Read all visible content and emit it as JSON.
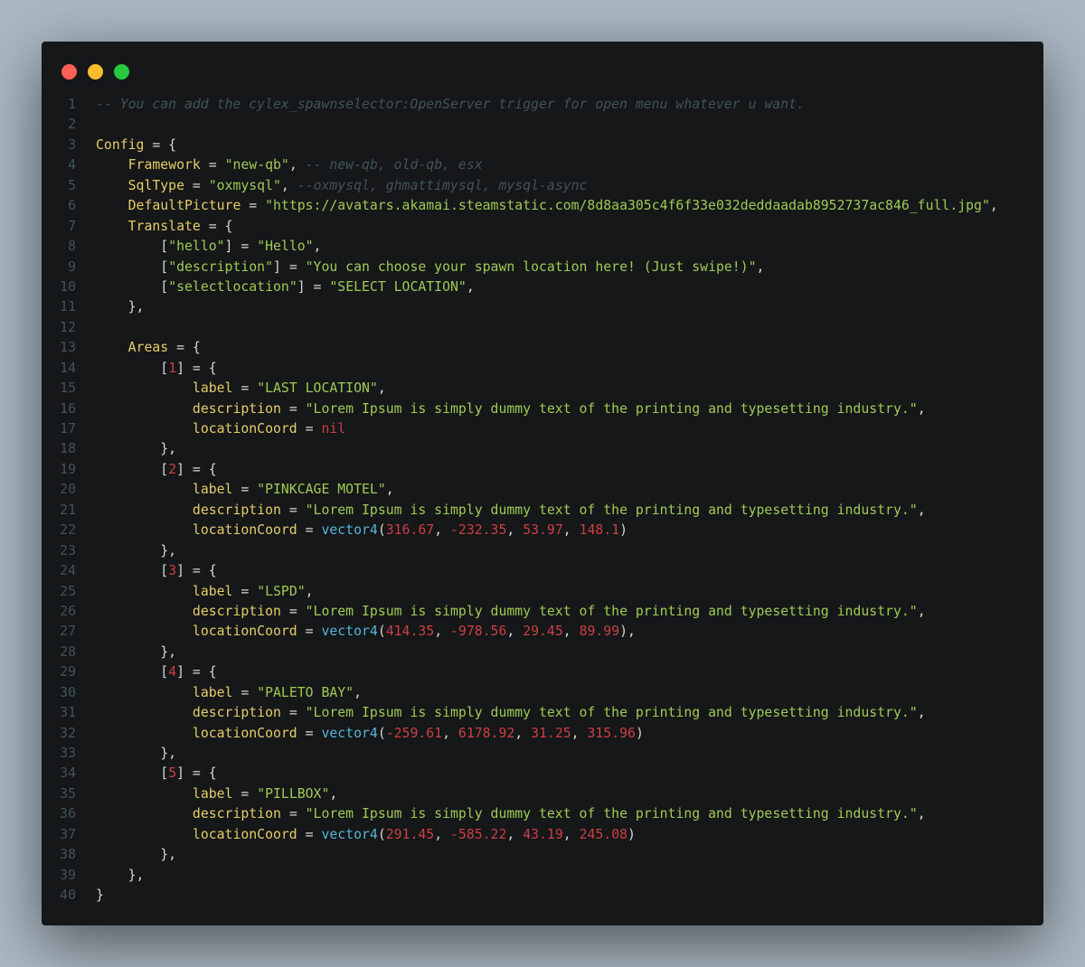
{
  "window": {
    "controls": [
      {
        "name": "close",
        "color": "#ff5f56"
      },
      {
        "name": "minimize",
        "color": "#ffbd2e"
      },
      {
        "name": "maximize",
        "color": "#27c93f"
      }
    ]
  },
  "theme": {
    "background": "#abb8c3",
    "editor_bg": "#151718",
    "line_number": "#41535b",
    "default": "#d4d7d6",
    "key": "#e6cd69",
    "string": "#9fca56",
    "comment": "#41535b",
    "number": "#cd3f45",
    "keyword": "#e6cd69",
    "function": "#55b5db",
    "ident": "#e6cd69"
  },
  "code": {
    "lines": [
      {
        "n": "1",
        "tokens": [
          [
            "c",
            "-- You can add the cylex_spawnselector:OpenServer trigger for open menu whatever u want."
          ]
        ]
      },
      {
        "n": "2",
        "tokens": []
      },
      {
        "n": "3",
        "tokens": [
          [
            "k",
            "Config"
          ],
          [
            "p",
            " = {"
          ]
        ]
      },
      {
        "n": "4",
        "tokens": [
          [
            "p",
            "    "
          ],
          [
            "k",
            "Framework"
          ],
          [
            "p",
            " = "
          ],
          [
            "s",
            "\"new-qb\""
          ],
          [
            "p",
            ", "
          ],
          [
            "c",
            "-- new-qb, old-qb, esx"
          ]
        ]
      },
      {
        "n": "5",
        "tokens": [
          [
            "p",
            "    "
          ],
          [
            "k",
            "SqlType"
          ],
          [
            "p",
            " = "
          ],
          [
            "s",
            "\"oxmysql\""
          ],
          [
            "p",
            ", "
          ],
          [
            "c",
            "--oxmysql, ghmattimysql, mysql-async"
          ]
        ]
      },
      {
        "n": "6",
        "tokens": [
          [
            "p",
            "    "
          ],
          [
            "k",
            "DefaultPicture"
          ],
          [
            "p",
            " = "
          ],
          [
            "s",
            "\"https://avatars.akamai.steamstatic.com/8d8aa305c4f6f33e032deddaadab8952737ac846_full.jpg\""
          ],
          [
            "p",
            ","
          ]
        ]
      },
      {
        "n": "7",
        "tokens": [
          [
            "p",
            "    "
          ],
          [
            "k",
            "Translate"
          ],
          [
            "p",
            " = {"
          ]
        ]
      },
      {
        "n": "8",
        "tokens": [
          [
            "p",
            "        ["
          ],
          [
            "s",
            "\"hello\""
          ],
          [
            "p",
            "] = "
          ],
          [
            "s",
            "\"Hello\""
          ],
          [
            "p",
            ","
          ]
        ]
      },
      {
        "n": "9",
        "tokens": [
          [
            "p",
            "        ["
          ],
          [
            "s",
            "\"description\""
          ],
          [
            "p",
            "] = "
          ],
          [
            "s",
            "\"You can choose your spawn location here! (Just swipe!)\""
          ],
          [
            "p",
            ","
          ]
        ]
      },
      {
        "n": "10",
        "tokens": [
          [
            "p",
            "        ["
          ],
          [
            "s",
            "\"selectlocation\""
          ],
          [
            "p",
            "] = "
          ],
          [
            "s",
            "\"SELECT LOCATION\""
          ],
          [
            "p",
            ","
          ]
        ]
      },
      {
        "n": "11",
        "tokens": [
          [
            "p",
            "    },"
          ]
        ]
      },
      {
        "n": "12",
        "tokens": []
      },
      {
        "n": "13",
        "tokens": [
          [
            "p",
            "    "
          ],
          [
            "k",
            "Areas"
          ],
          [
            "p",
            " = {"
          ]
        ]
      },
      {
        "n": "14",
        "tokens": [
          [
            "p",
            "        ["
          ],
          [
            "n",
            "1"
          ],
          [
            "p",
            "] = {"
          ]
        ]
      },
      {
        "n": "15",
        "tokens": [
          [
            "p",
            "            "
          ],
          [
            "k",
            "label"
          ],
          [
            "p",
            " = "
          ],
          [
            "s",
            "\"LAST LOCATION\""
          ],
          [
            "p",
            ","
          ]
        ]
      },
      {
        "n": "16",
        "tokens": [
          [
            "p",
            "            "
          ],
          [
            "k",
            "description"
          ],
          [
            "p",
            " = "
          ],
          [
            "s",
            "\"Lorem Ipsum is simply dummy text of the printing and typesetting industry.\""
          ],
          [
            "p",
            ","
          ]
        ]
      },
      {
        "n": "17",
        "tokens": [
          [
            "p",
            "            "
          ],
          [
            "k",
            "locationCoord"
          ],
          [
            "p",
            " = "
          ],
          [
            "n",
            "nil"
          ]
        ]
      },
      {
        "n": "18",
        "tokens": [
          [
            "p",
            "        },"
          ]
        ]
      },
      {
        "n": "19",
        "tokens": [
          [
            "p",
            "        ["
          ],
          [
            "n",
            "2"
          ],
          [
            "p",
            "] = {"
          ]
        ]
      },
      {
        "n": "20",
        "tokens": [
          [
            "p",
            "            "
          ],
          [
            "k",
            "label"
          ],
          [
            "p",
            " = "
          ],
          [
            "s",
            "\"PINKCAGE MOTEL\""
          ],
          [
            "p",
            ","
          ]
        ]
      },
      {
        "n": "21",
        "tokens": [
          [
            "p",
            "            "
          ],
          [
            "k",
            "description"
          ],
          [
            "p",
            " = "
          ],
          [
            "s",
            "\"Lorem Ipsum is simply dummy text of the printing and typesetting industry.\""
          ],
          [
            "p",
            ","
          ]
        ]
      },
      {
        "n": "22",
        "tokens": [
          [
            "p",
            "            "
          ],
          [
            "k",
            "locationCoord"
          ],
          [
            "p",
            " = "
          ],
          [
            "f",
            "vector4"
          ],
          [
            "p",
            "("
          ],
          [
            "n",
            "316.67"
          ],
          [
            "p",
            ", "
          ],
          [
            "n",
            "-232.35"
          ],
          [
            "p",
            ", "
          ],
          [
            "n",
            "53.97"
          ],
          [
            "p",
            ", "
          ],
          [
            "n",
            "148.1"
          ],
          [
            "p",
            ")"
          ]
        ]
      },
      {
        "n": "23",
        "tokens": [
          [
            "p",
            "        },"
          ]
        ]
      },
      {
        "n": "24",
        "tokens": [
          [
            "p",
            "        ["
          ],
          [
            "n",
            "3"
          ],
          [
            "p",
            "] = {"
          ]
        ]
      },
      {
        "n": "25",
        "tokens": [
          [
            "p",
            "            "
          ],
          [
            "k",
            "label"
          ],
          [
            "p",
            " = "
          ],
          [
            "s",
            "\"LSPD\""
          ],
          [
            "p",
            ","
          ]
        ]
      },
      {
        "n": "26",
        "tokens": [
          [
            "p",
            "            "
          ],
          [
            "k",
            "description"
          ],
          [
            "p",
            " = "
          ],
          [
            "s",
            "\"Lorem Ipsum is simply dummy text of the printing and typesetting industry.\""
          ],
          [
            "p",
            ","
          ]
        ]
      },
      {
        "n": "27",
        "tokens": [
          [
            "p",
            "            "
          ],
          [
            "k",
            "locationCoord"
          ],
          [
            "p",
            " = "
          ],
          [
            "f",
            "vector4"
          ],
          [
            "p",
            "("
          ],
          [
            "n",
            "414.35"
          ],
          [
            "p",
            ", "
          ],
          [
            "n",
            "-978.56"
          ],
          [
            "p",
            ", "
          ],
          [
            "n",
            "29.45"
          ],
          [
            "p",
            ", "
          ],
          [
            "n",
            "89.99"
          ],
          [
            "p",
            "),"
          ]
        ]
      },
      {
        "n": "28",
        "tokens": [
          [
            "p",
            "        },"
          ]
        ]
      },
      {
        "n": "29",
        "tokens": [
          [
            "p",
            "        ["
          ],
          [
            "n",
            "4"
          ],
          [
            "p",
            "] = {"
          ]
        ]
      },
      {
        "n": "30",
        "tokens": [
          [
            "p",
            "            "
          ],
          [
            "k",
            "label"
          ],
          [
            "p",
            " = "
          ],
          [
            "s",
            "\"PALETO BAY\""
          ],
          [
            "p",
            ","
          ]
        ]
      },
      {
        "n": "31",
        "tokens": [
          [
            "p",
            "            "
          ],
          [
            "k",
            "description"
          ],
          [
            "p",
            " = "
          ],
          [
            "s",
            "\"Lorem Ipsum is simply dummy text of the printing and typesetting industry.\""
          ],
          [
            "p",
            ","
          ]
        ]
      },
      {
        "n": "32",
        "tokens": [
          [
            "p",
            "            "
          ],
          [
            "k",
            "locationCoord"
          ],
          [
            "p",
            " = "
          ],
          [
            "f",
            "vector4"
          ],
          [
            "p",
            "("
          ],
          [
            "n",
            "-259.61"
          ],
          [
            "p",
            ", "
          ],
          [
            "n",
            "6178.92"
          ],
          [
            "p",
            ", "
          ],
          [
            "n",
            "31.25"
          ],
          [
            "p",
            ", "
          ],
          [
            "n",
            "315.96"
          ],
          [
            "p",
            ")"
          ]
        ]
      },
      {
        "n": "33",
        "tokens": [
          [
            "p",
            "        },"
          ]
        ]
      },
      {
        "n": "34",
        "tokens": [
          [
            "p",
            "        ["
          ],
          [
            "n",
            "5"
          ],
          [
            "p",
            "] = {"
          ]
        ]
      },
      {
        "n": "35",
        "tokens": [
          [
            "p",
            "            "
          ],
          [
            "k",
            "label"
          ],
          [
            "p",
            " = "
          ],
          [
            "s",
            "\"PILLBOX\""
          ],
          [
            "p",
            ","
          ]
        ]
      },
      {
        "n": "36",
        "tokens": [
          [
            "p",
            "            "
          ],
          [
            "k",
            "description"
          ],
          [
            "p",
            " = "
          ],
          [
            "s",
            "\"Lorem Ipsum is simply dummy text of the printing and typesetting industry.\""
          ],
          [
            "p",
            ","
          ]
        ]
      },
      {
        "n": "37",
        "tokens": [
          [
            "p",
            "            "
          ],
          [
            "k",
            "locationCoord"
          ],
          [
            "p",
            " = "
          ],
          [
            "f",
            "vector4"
          ],
          [
            "p",
            "("
          ],
          [
            "n",
            "291.45"
          ],
          [
            "p",
            ", "
          ],
          [
            "n",
            "-585.22"
          ],
          [
            "p",
            ", "
          ],
          [
            "n",
            "43.19"
          ],
          [
            "p",
            ", "
          ],
          [
            "n",
            "245.08"
          ],
          [
            "p",
            ")"
          ]
        ]
      },
      {
        "n": "38",
        "tokens": [
          [
            "p",
            "        },"
          ]
        ]
      },
      {
        "n": "39",
        "tokens": [
          [
            "p",
            "    },"
          ]
        ]
      },
      {
        "n": "40",
        "tokens": [
          [
            "p",
            "}"
          ]
        ]
      }
    ]
  }
}
